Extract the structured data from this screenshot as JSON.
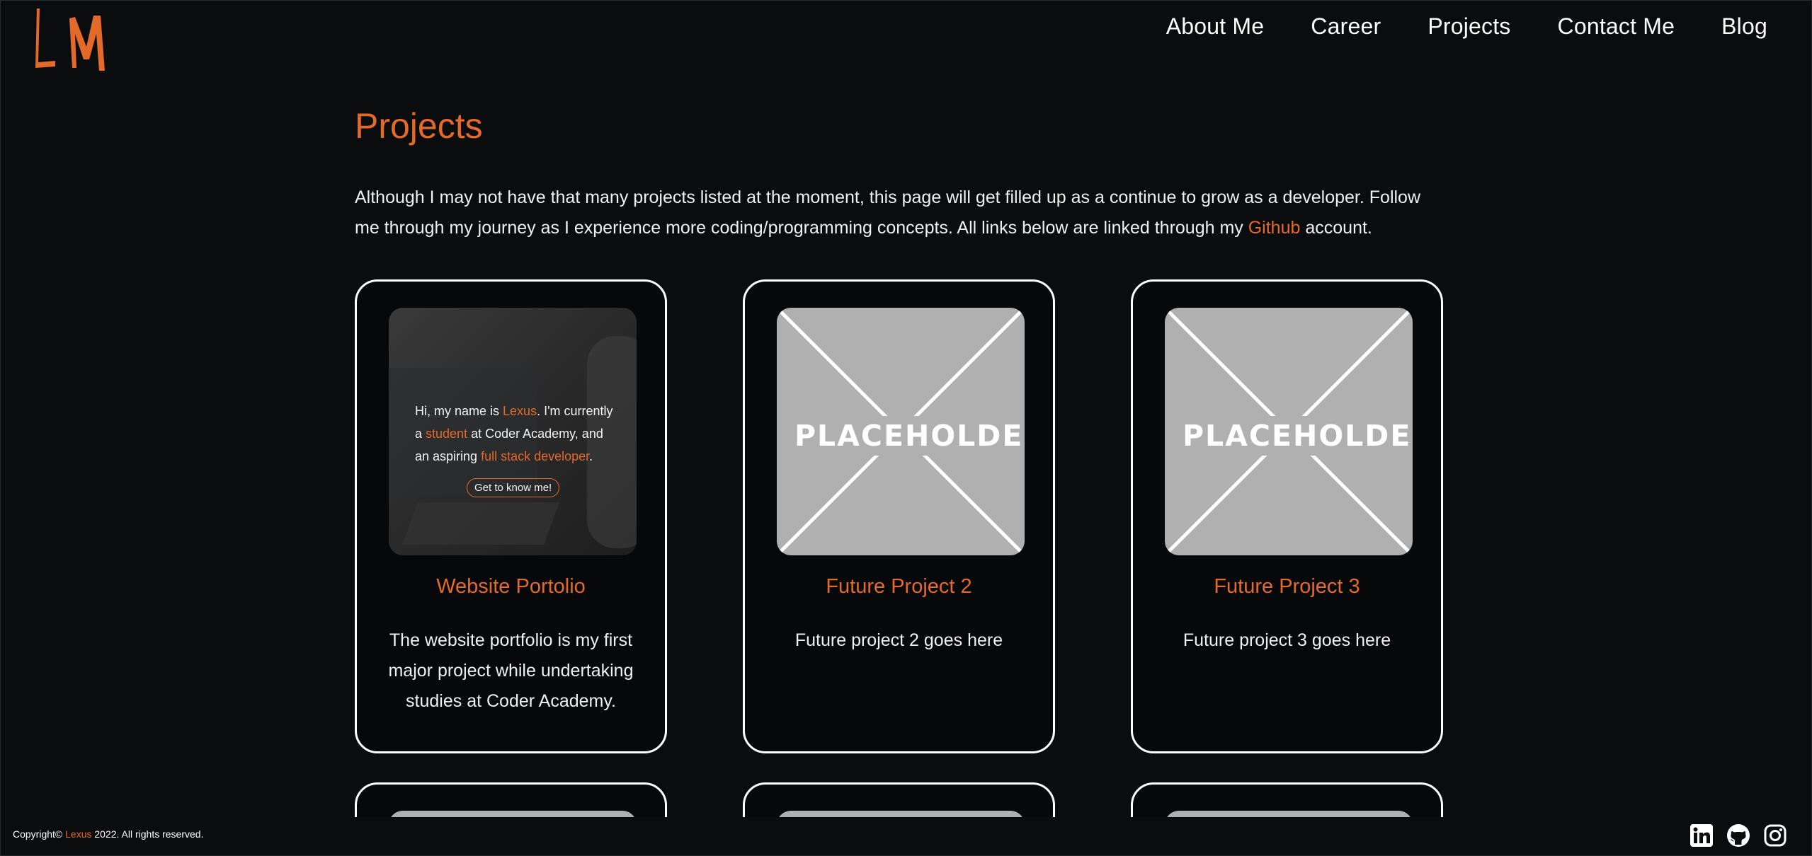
{
  "header": {
    "logo_text": "LM",
    "nav": [
      "About Me",
      "Career",
      "Projects",
      "Contact Me",
      "Blog"
    ]
  },
  "page": {
    "title": "Projects",
    "intro_part1": "Although I may not have that many projects listed at the moment, this page will get filled up as a continue to grow as a developer. Follow me through my journey as I experience more coding/programming concepts. All links below are linked through my ",
    "intro_link": "Github",
    "intro_part2": " account."
  },
  "projects": [
    {
      "title": "Website Portolio",
      "description": "The website portfolio is my first major project while undertaking studies at Coder Academy.",
      "thumb": {
        "line_a": "Hi, my name is ",
        "name": "Lexus",
        "line_b": ". I'm currently a ",
        "role": "student",
        "line_c": " at Coder Academy, and an aspiring ",
        "goal": "full stack developer",
        "line_d": ".",
        "button": "Get to know me!"
      }
    },
    {
      "title": "Future Project 2",
      "description": "Future project 2 goes here",
      "placeholder": "PLACEHOLDER"
    },
    {
      "title": "Future Project 3",
      "description": "Future project 3 goes here",
      "placeholder": "PLACEHOLDER"
    }
  ],
  "footer": {
    "copy_prefix": "Copyright© ",
    "copy_name": "Lexus",
    "copy_suffix": " 2022. All rights reserved.",
    "social": [
      "linkedin-icon",
      "github-icon",
      "instagram-icon"
    ]
  },
  "colors": {
    "accent": "#e46a2a",
    "background": "#0b0c0e",
    "placeholder": "#b0b0b0"
  }
}
